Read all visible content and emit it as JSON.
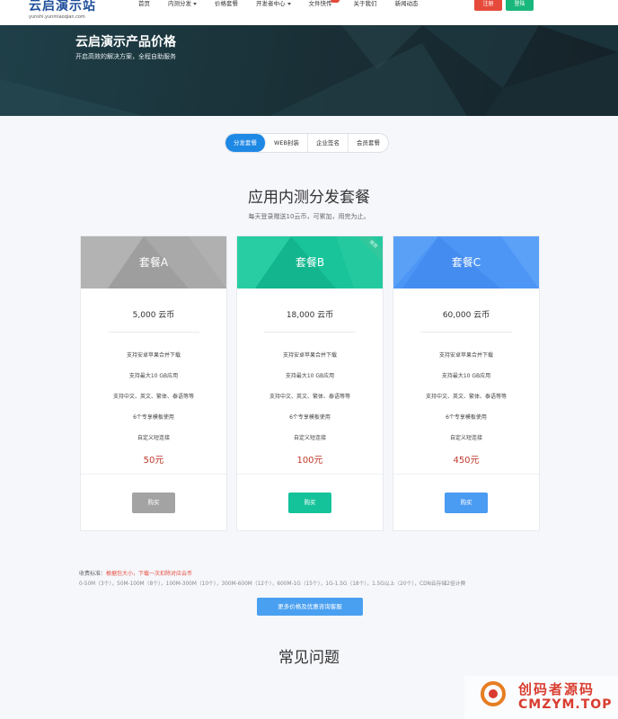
{
  "nav": {
    "logo_name": "云启演示站",
    "logo_sub": "yunshi.yunmiaoqian.com",
    "items": [
      "首页",
      "内测分发",
      "价格套餐",
      "开发者中心",
      "文件快传",
      "关于我们",
      "新闻动态"
    ],
    "register": "注册",
    "login": "登陆"
  },
  "hero": {
    "title": "云启演示产品价格",
    "desc": "开启高效的解决方案，全程自助服务"
  },
  "tabs": [
    "分发套餐",
    "WEB封装",
    "企业签名",
    "会员套餐"
  ],
  "section": {
    "title": "应用内测分发套餐",
    "subtitle": "每天登录赠送10云币，可累加，用完为止。"
  },
  "plans": [
    {
      "name": "套餐A",
      "coins": "5,000 云币",
      "features": [
        "支持安卓苹果合并下载",
        "支持最大10 GB应用",
        "支持中文、英文、繁体、泰语等等",
        "6个专享模板使用",
        "自定义短连接"
      ],
      "price": "50元",
      "buy": "购买",
      "color": "#a7a7a7",
      "ribbon": ""
    },
    {
      "name": "套餐B",
      "coins": "18,000 云币",
      "features": [
        "支持安卓苹果合并下载",
        "支持最大10 GB应用",
        "支持中文、英文、繁体、泰语等等",
        "6个专享模板使用",
        "自定义短连接"
      ],
      "price": "100元",
      "buy": "购买",
      "color": "#17c499",
      "ribbon": "推荐"
    },
    {
      "name": "套餐C",
      "coins": "60,000 云币",
      "features": [
        "支持安卓苹果合并下载",
        "支持最大10 GB应用",
        "支持中文、英文、繁体、泰语等等",
        "6个专享模板使用",
        "自定义短连接"
      ],
      "price": "450元",
      "buy": "购买",
      "color": "#4f97f5",
      "ribbon": ""
    }
  ],
  "note": {
    "label": "收费标准：",
    "highlight": "根据包大小，下载一次扣除对应云币",
    "tiers": "0-50M（3个），50M-100M（8个），100M-300M（10个），300M-600M（12个），600M-1G（15个），1G-1.5G（18个），1.5G以上（20个），CDN云存储2倍计费"
  },
  "more_button": "更多价格及优惠咨询客服",
  "faq_title": "常见问题",
  "watermark": {
    "line1": "创码者源码",
    "line2": "CMZYM.TOP"
  }
}
